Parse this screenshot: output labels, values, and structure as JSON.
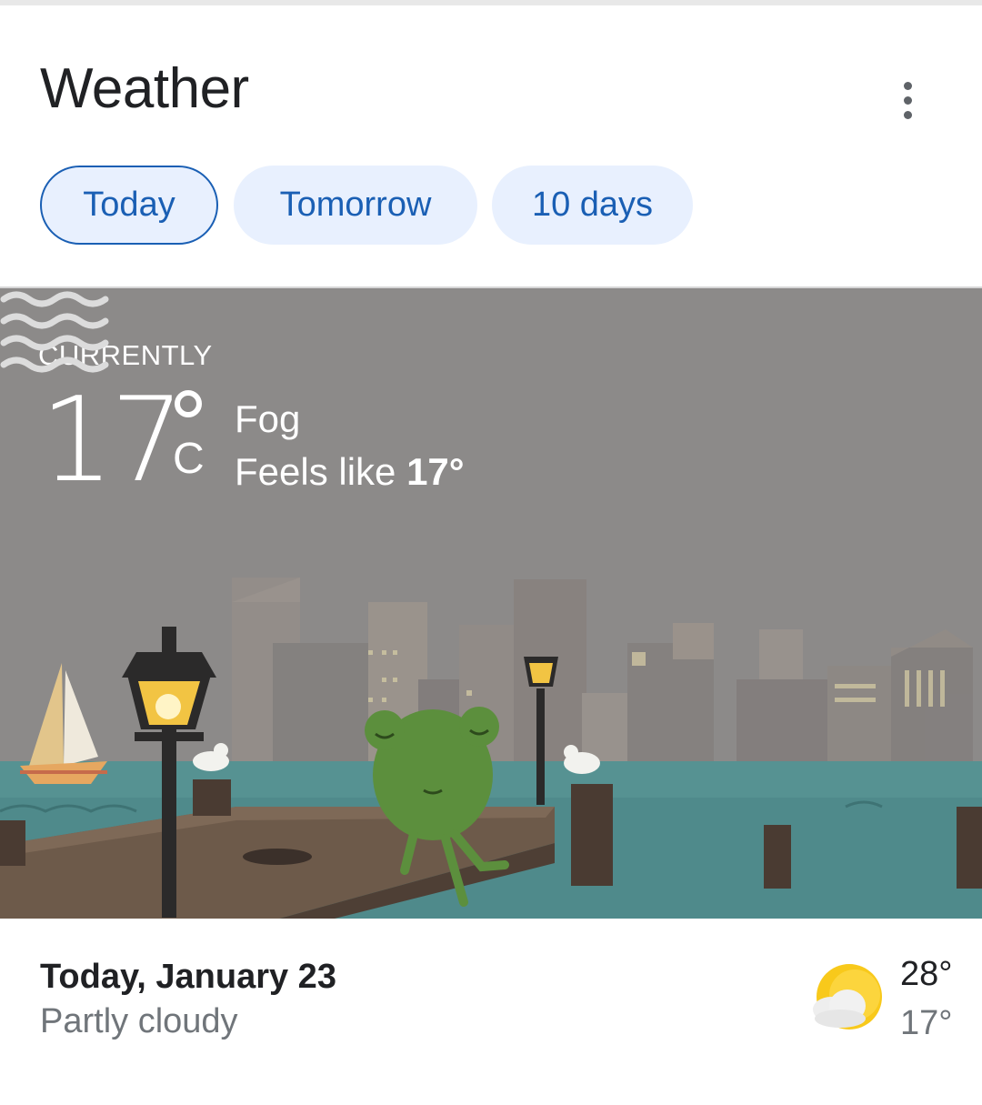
{
  "header": {
    "title": "Weather"
  },
  "tabs": [
    {
      "label": "Today",
      "active": true
    },
    {
      "label": "Tomorrow",
      "active": false
    },
    {
      "label": "10 days",
      "active": false
    }
  ],
  "current": {
    "section_label": "CURRENTLY",
    "temperature": "17",
    "unit": "C",
    "condition": "Fog",
    "feels_like_prefix": "Feels like",
    "feels_like_value": "17°",
    "icon": "fog-icon"
  },
  "summary": {
    "date": "Today, January 23",
    "condition": "Partly cloudy",
    "high": "28°",
    "low": "17°",
    "icon": "partly-cloudy-icon"
  },
  "colors": {
    "accent": "#1a5fb4",
    "chip_bg": "#e8f0fe",
    "scene_sky": "#8c8a89",
    "water": "#4f8a8b"
  }
}
